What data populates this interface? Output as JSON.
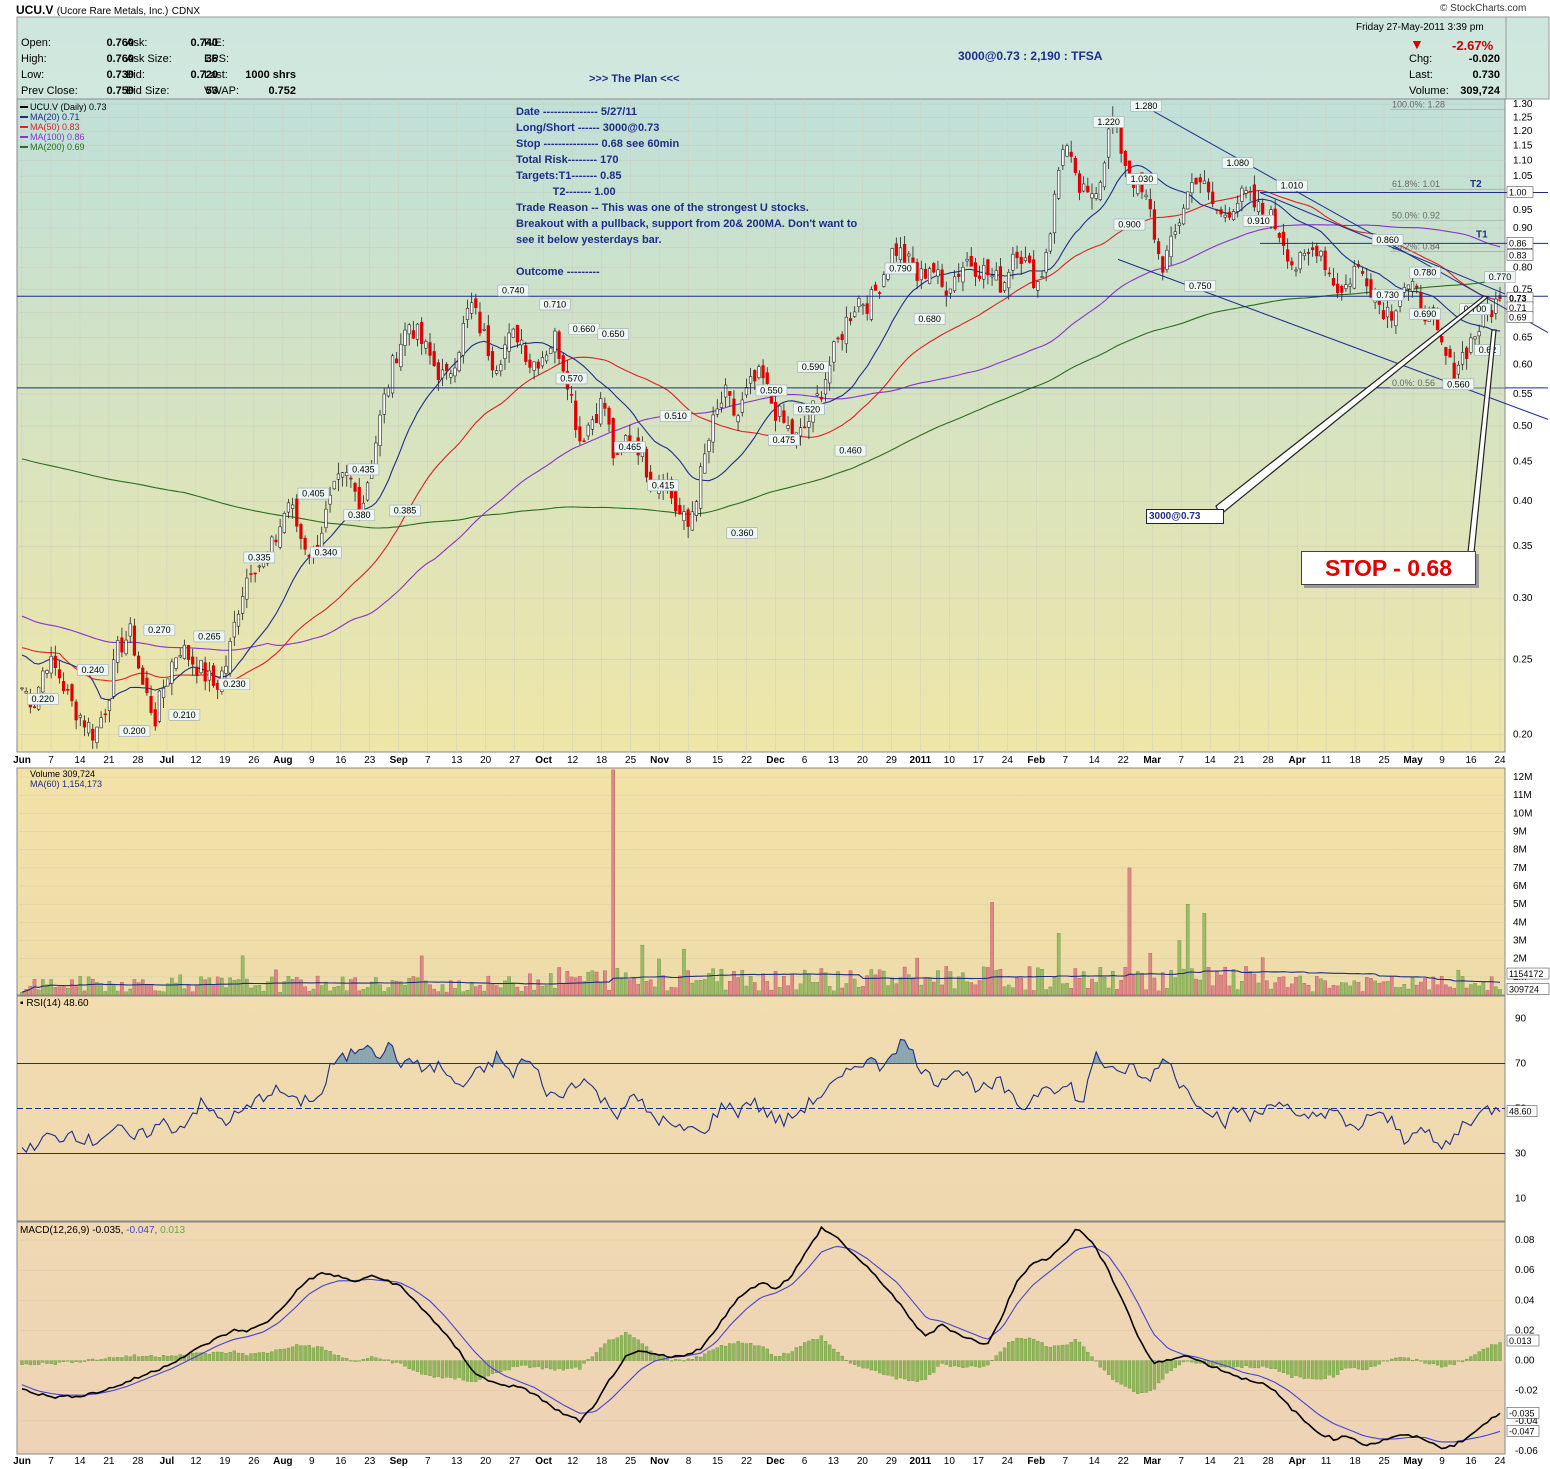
{
  "header": {
    "symbol": "UCU.V",
    "company": "(Ucore Rare Metals, Inc.)",
    "exchange": "CDNX",
    "brand": "© StockCharts.com",
    "date": "Friday  27-May-2011  3:39 pm",
    "change_pct": "-2.67%",
    "quote_left": [
      {
        "label": "Open:",
        "value": "0.760"
      },
      {
        "label": "High:",
        "value": "0.760"
      },
      {
        "label": "Low:",
        "value": "0.730"
      },
      {
        "label": "Prev Close:",
        "value": "0.750"
      }
    ],
    "quote_mid": [
      {
        "label": "Ask:",
        "value": "0.740"
      },
      {
        "label": "Ask Size:",
        "value": "36"
      },
      {
        "label": "Bid:",
        "value": "0.720"
      },
      {
        "label": "Bid Size:",
        "value": "53"
      }
    ],
    "quote_right": [
      {
        "label": "P/E:",
        "value": ""
      },
      {
        "label": "EPS:",
        "value": ""
      },
      {
        "label": "Last:",
        "value": "1000 shrs"
      },
      {
        "label": "VWAP:",
        "value": "0.752"
      }
    ],
    "quote_far": [
      {
        "label": "Chg:",
        "value": "-0.020"
      },
      {
        "label": "Last:",
        "value": "0.730"
      },
      {
        "label": "Volume:",
        "value": "309,724"
      }
    ],
    "trade_title": "3000@0.73 : 2,190 : TFSA",
    "plan_title": ">>> The Plan <<<"
  },
  "plan_lines": [
    "Date --------------- 5/27/11",
    "Long/Short ------ 3000@0.73",
    "Stop --------------- 0.68 see 60min",
    "Total Risk-------- 170",
    "Targets:T1------- 0.85",
    "            T2------- 1.00",
    "Trade Reason -- This was one of the strongest U stocks.",
    "Breakout with a pullback, support from 20& 200MA. Don't want to",
    "see it below yesterdays bar.",
    "",
    "Outcome ---------"
  ],
  "annotations": {
    "stop_box": "STOP - 0.68",
    "entry_box": "3000@0.73",
    "t1": "T1",
    "t2": "T2"
  },
  "colors": {
    "up": "#ffffff",
    "down": "#e00000",
    "ma20": "#1c2e8a",
    "ma50": "#dd2222",
    "ma100": "#8833cc",
    "ma200": "#2a6e1e",
    "trend": "#1c2e8a",
    "vol_up": "#99bb66",
    "vol_down": "#dd8888",
    "rsi": "#1c2e8a",
    "macd": "#000000",
    "signal": "#4444cc"
  },
  "chart_data": [
    {
      "panel": "price",
      "type": "candlestick",
      "legend": [
        "UCU.V (Daily) 0.73",
        "MA(20) 0.71",
        "MA(50) 0.83",
        "MA(100) 0.86",
        "MA(200) 0.69"
      ],
      "y_scale": "log",
      "ylim": [
        0.19,
        1.32
      ],
      "y_ticks": [
        0.2,
        0.25,
        0.3,
        0.35,
        0.4,
        0.45,
        0.5,
        0.55,
        0.6,
        0.65,
        0.7,
        0.75,
        0.8,
        0.85,
        0.9,
        0.95,
        1.0,
        1.05,
        1.1,
        1.15,
        1.2,
        1.25,
        1.3
      ],
      "x_labels": [
        "Jun",
        "7",
        "14",
        "21",
        "28",
        "Jul",
        "12",
        "19",
        "26",
        "Aug",
        "9",
        "16",
        "23",
        "Sep",
        "7",
        "13",
        "20",
        "27",
        "Oct",
        "12",
        "18",
        "25",
        "Nov",
        "8",
        "15",
        "22",
        "Dec",
        "6",
        "13",
        "20",
        "29",
        "2011",
        "10",
        "17",
        "24",
        "Feb",
        "7",
        "14",
        "22",
        "Mar",
        "7",
        "14",
        "21",
        "28",
        "Apr",
        "11",
        "18",
        "25",
        "May",
        "9",
        "16",
        "24"
      ],
      "close_path": [
        0.23,
        0.22,
        0.25,
        0.24,
        0.22,
        0.21,
        0.2,
        0.22,
        0.26,
        0.27,
        0.23,
        0.21,
        0.24,
        0.26,
        0.25,
        0.24,
        0.23,
        0.25,
        0.3,
        0.335,
        0.33,
        0.36,
        0.4,
        0.36,
        0.34,
        0.38,
        0.42,
        0.43,
        0.39,
        0.46,
        0.55,
        0.63,
        0.68,
        0.64,
        0.6,
        0.57,
        0.63,
        0.72,
        0.66,
        0.6,
        0.64,
        0.66,
        0.6,
        0.62,
        0.65,
        0.58,
        0.48,
        0.51,
        0.54,
        0.44,
        0.49,
        0.47,
        0.42,
        0.43,
        0.39,
        0.37,
        0.43,
        0.5,
        0.55,
        0.51,
        0.56,
        0.58,
        0.53,
        0.5,
        0.48,
        0.51,
        0.56,
        0.62,
        0.68,
        0.73,
        0.72,
        0.78,
        0.85,
        0.82,
        0.77,
        0.81,
        0.75,
        0.78,
        0.82,
        0.8,
        0.78,
        0.76,
        0.86,
        0.8,
        0.76,
        0.92,
        1.18,
        1.02,
        0.98,
        1.05,
        1.25,
        1.1,
        1.02,
        0.96,
        0.8,
        0.86,
        0.98,
        1.06,
        0.98,
        0.93,
        0.97,
        0.99,
        0.95,
        0.93,
        0.88,
        0.8,
        0.82,
        0.86,
        0.78,
        0.74,
        0.8,
        0.78,
        0.72,
        0.7,
        0.76,
        0.74,
        0.7,
        0.64,
        0.59,
        0.62,
        0.66,
        0.7,
        0.73
      ],
      "price_labels": [
        {
          "label": "0.220",
          "i": 5
        },
        {
          "label": "0.240",
          "i": 17
        },
        {
          "label": "0.200",
          "i": 27
        },
        {
          "label": "0.270",
          "i": 33
        },
        {
          "label": "0.210",
          "i": 39
        },
        {
          "label": "0.265",
          "i": 45
        },
        {
          "label": "0.230",
          "i": 51
        },
        {
          "label": "0.335",
          "i": 57
        },
        {
          "label": "0.340",
          "i": 72
        },
        {
          "label": "0.405",
          "i": 69
        },
        {
          "label": "0.380",
          "i": 80
        },
        {
          "label": "0.435",
          "i": 81
        },
        {
          "label": "0.385",
          "i": 91
        },
        {
          "label": "0.740",
          "i": 117
        },
        {
          "label": "0.710",
          "i": 127
        },
        {
          "label": "0.660",
          "i": 134
        },
        {
          "label": "0.650",
          "i": 141
        },
        {
          "label": "0.570",
          "i": 131
        },
        {
          "label": "0.465",
          "i": 145
        },
        {
          "label": "0.510",
          "i": 156
        },
        {
          "label": "0.415",
          "i": 153
        },
        {
          "label": "0.360",
          "i": 172
        },
        {
          "label": "0.550",
          "i": 178
        },
        {
          "label": "0.475",
          "i": 181
        },
        {
          "label": "0.590",
          "i": 188
        },
        {
          "label": "0.520",
          "i": 187
        },
        {
          "label": "0.460",
          "i": 197
        },
        {
          "label": "0.790",
          "i": 209
        },
        {
          "label": "0.680",
          "i": 216
        },
        {
          "label": "1.220",
          "i": 259
        },
        {
          "label": "0.900",
          "i": 264
        },
        {
          "label": "1.280",
          "i": 268
        },
        {
          "label": "1.030",
          "i": 267
        },
        {
          "label": "0.750",
          "i": 281
        },
        {
          "label": "1.080",
          "i": 290
        },
        {
          "label": "0.910",
          "i": 294
        },
        {
          "label": "1.010",
          "i": 302
        },
        {
          "label": "0.860",
          "i": 325
        },
        {
          "label": "0.730",
          "i": 325
        },
        {
          "label": "0.780",
          "i": 334
        },
        {
          "label": "0.690",
          "i": 334
        },
        {
          "label": "0.700",
          "i": 346
        },
        {
          "label": "0.770",
          "i": 352
        },
        {
          "label": "0.560",
          "i": 342
        },
        {
          "label": "0.62",
          "i": 349
        }
      ],
      "fib_levels": [
        {
          "label": "100.0%: 1.28",
          "value": 1.28
        },
        {
          "label": "61.8%: 1.01",
          "value": 1.01
        },
        {
          "label": "50.0%: 0.92",
          "value": 0.92
        },
        {
          "label": "38.2%: 0.84",
          "value": 0.84
        },
        {
          "label": "0.0%: 0.56",
          "value": 0.56
        }
      ],
      "horizontal_lines": [
        0.735,
        0.56,
        1.0,
        0.86
      ],
      "right_tags": [
        {
          "label": "1.00",
          "value": 1.0
        },
        {
          "label": "0.86",
          "value": 0.86
        },
        {
          "label": "0.83",
          "value": 0.83
        },
        {
          "label": "0.73",
          "value": 0.73
        },
        {
          "label": "0.71",
          "value": 0.71
        },
        {
          "label": "0.69",
          "value": 0.69
        }
      ]
    },
    {
      "panel": "volume",
      "type": "bar",
      "legend": [
        "Volume 309,724",
        "MA(60) 1,154,173"
      ],
      "ylim": [
        0,
        12500000
      ],
      "y_ticks_labels": [
        "1M",
        "2M",
        "3M",
        "4M",
        "5M",
        "6M",
        "7M",
        "8M",
        "9M",
        "10M",
        "11M",
        "12M"
      ],
      "y_ticks_values": [
        1000000,
        2000000,
        3000000,
        4000000,
        5000000,
        6000000,
        7000000,
        8000000,
        9000000,
        10000000,
        11000000,
        12000000
      ],
      "right_tags": [
        {
          "label": "1154172",
          "value": 1154172
        },
        {
          "label": "309724",
          "value": 309724
        }
      ],
      "spikes": [
        {
          "i": 141,
          "value": 12400000
        },
        {
          "i": 264,
          "value": 7000000
        },
        {
          "i": 231,
          "value": 5100000
        },
        {
          "i": 278,
          "value": 5000000
        },
        {
          "i": 276,
          "value": 4400000
        },
        {
          "i": 282,
          "value": 4500000
        },
        {
          "i": 276,
          "value": 3000000
        }
      ]
    },
    {
      "panel": "rsi",
      "type": "line",
      "legend": [
        "RSI(14) 48.60"
      ],
      "ylim": [
        0,
        100
      ],
      "y_ticks": [
        10,
        30,
        50,
        70,
        90
      ],
      "right_tags": [
        {
          "label": "48.60",
          "value": 48.6
        }
      ],
      "path": [
        34,
        31,
        38,
        36,
        40,
        37,
        35,
        39,
        42,
        36,
        38,
        41,
        44,
        40,
        46,
        52,
        48,
        44,
        47,
        50,
        55,
        58,
        57,
        52,
        55,
        54,
        70,
        72,
        76,
        80,
        74,
        78,
        68,
        72,
        66,
        70,
        62,
        60,
        65,
        68,
        74,
        64,
        72,
        68,
        58,
        54,
        60,
        64,
        58,
        52,
        48,
        55,
        52,
        46,
        44,
        40,
        42,
        38,
        46,
        52,
        48,
        54,
        50,
        46,
        44,
        48,
        52,
        56,
        60,
        64,
        70,
        72,
        68,
        76,
        80,
        72,
        64,
        62,
        68,
        66,
        60,
        58,
        62,
        54,
        50,
        56,
        62,
        58,
        60,
        50,
        76,
        68,
        64,
        70,
        62,
        66,
        74,
        62,
        56,
        52,
        48,
        44,
        50,
        46,
        48,
        54,
        52,
        44,
        46,
        48,
        50,
        42,
        40,
        48,
        46,
        44,
        36,
        42,
        38,
        32,
        36,
        44,
        46,
        50,
        48.6
      ]
    },
    {
      "panel": "macd",
      "type": "line",
      "legend_prefix": "MACD(12,26,9)",
      "legend_values": [
        "-0.035,",
        "-0.047,",
        "0.013"
      ],
      "ylim": [
        -0.062,
        0.092
      ],
      "y_ticks": [
        -0.06,
        -0.04,
        -0.02,
        0.0,
        0.02,
        0.04,
        0.06,
        0.08
      ],
      "y_tick_labels": [
        "-0.06",
        "-0.04",
        "-0.02",
        "0.00",
        "0.02",
        "0.04",
        "0.06",
        "0.08"
      ],
      "right_tags": [
        {
          "label": "0.013",
          "value": 0.013
        },
        {
          "label": "-0.035",
          "value": -0.035
        },
        {
          "label": "-0.047",
          "value": -0.047
        }
      ],
      "macd_path": [
        -0.018,
        -0.022,
        -0.024,
        -0.024,
        -0.023,
        -0.021,
        -0.018,
        -0.014,
        -0.01,
        -0.006,
        -0.001,
        0.004,
        0.01,
        0.015,
        0.02,
        0.02,
        0.024,
        0.032,
        0.044,
        0.054,
        0.058,
        0.056,
        0.052,
        0.056,
        0.054,
        0.05,
        0.04,
        0.03,
        0.018,
        0.006,
        -0.008,
        -0.014,
        -0.016,
        -0.018,
        -0.022,
        -0.03,
        -0.036,
        -0.04,
        -0.03,
        -0.012,
        0.002,
        0.006,
        0.004,
        0.002,
        0.004,
        0.008,
        0.02,
        0.036,
        0.046,
        0.052,
        0.048,
        0.056,
        0.072,
        0.088,
        0.082,
        0.072,
        0.062,
        0.052,
        0.04,
        0.026,
        0.016,
        0.024,
        0.018,
        0.014,
        0.01,
        0.03,
        0.054,
        0.064,
        0.068,
        0.076,
        0.088,
        0.078,
        0.06,
        0.04,
        0.016,
        -0.002,
        0.0,
        0.004,
        0.0,
        -0.004,
        -0.008,
        -0.012,
        -0.014,
        -0.02,
        -0.03,
        -0.04,
        -0.048,
        -0.052,
        -0.05,
        -0.056,
        -0.054,
        -0.05,
        -0.05,
        -0.052,
        -0.058,
        -0.056,
        -0.05,
        -0.042,
        -0.035
      ],
      "signal_path": [
        -0.016,
        -0.02,
        -0.022,
        -0.023,
        -0.023,
        -0.022,
        -0.02,
        -0.017,
        -0.013,
        -0.009,
        -0.005,
        0.0,
        0.005,
        0.01,
        0.014,
        0.016,
        0.019,
        0.025,
        0.034,
        0.044,
        0.05,
        0.053,
        0.053,
        0.054,
        0.053,
        0.052,
        0.047,
        0.04,
        0.03,
        0.018,
        0.006,
        -0.004,
        -0.01,
        -0.014,
        -0.018,
        -0.024,
        -0.03,
        -0.035,
        -0.034,
        -0.026,
        -0.016,
        -0.006,
        0.0,
        0.002,
        0.003,
        0.005,
        0.012,
        0.024,
        0.034,
        0.042,
        0.045,
        0.05,
        0.06,
        0.072,
        0.076,
        0.074,
        0.068,
        0.06,
        0.052,
        0.04,
        0.028,
        0.026,
        0.022,
        0.018,
        0.014,
        0.022,
        0.038,
        0.05,
        0.058,
        0.066,
        0.074,
        0.076,
        0.07,
        0.056,
        0.038,
        0.018,
        0.008,
        0.004,
        0.002,
        -0.001,
        -0.004,
        -0.008,
        -0.01,
        -0.014,
        -0.02,
        -0.028,
        -0.036,
        -0.042,
        -0.046,
        -0.05,
        -0.052,
        -0.052,
        -0.051,
        -0.051,
        -0.054,
        -0.054,
        -0.052,
        -0.05,
        -0.047
      ]
    }
  ]
}
